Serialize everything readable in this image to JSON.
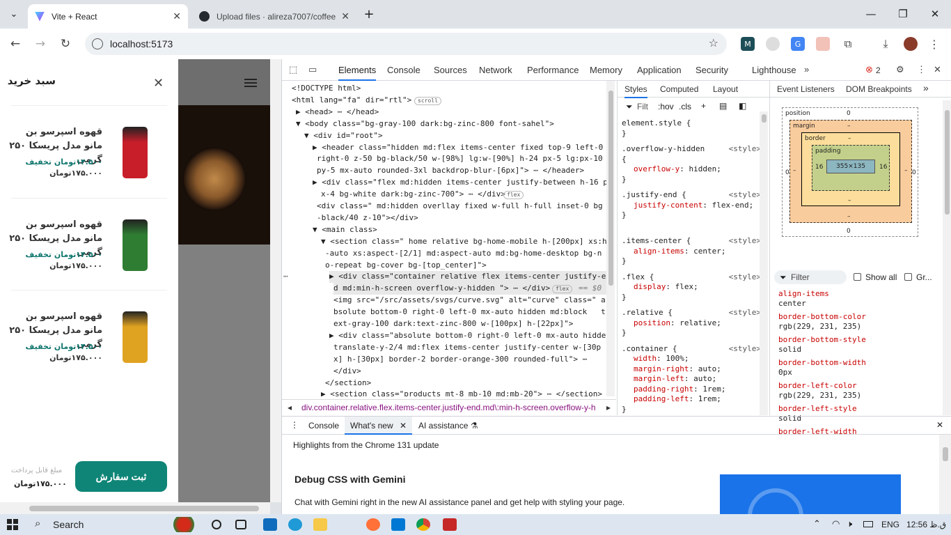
{
  "tabs": [
    {
      "title": "Vite + React",
      "active": true
    },
    {
      "title": "Upload files · alireza7007/coffee",
      "active": false
    }
  ],
  "address": {
    "url": "localhost:5173"
  },
  "cart": {
    "title": "سبد خرید",
    "items": [
      {
        "name": "قهوه اسپرسو بن مانو مدل پریسکا ۲۵۰ گرمی",
        "discount": "۱۴.۵۰۰تومان تخفیف",
        "price": "۱۷۵.۰۰۰تومان",
        "pack_color": "#c81e2a"
      },
      {
        "name": "قهوه اسپرسو بن مانو مدل پریسکا ۲۵۰ گرمی",
        "discount": "۱۴.۵۰۰تومان تخفیف",
        "price": "۱۷۵.۰۰۰تومان",
        "pack_color": "#2f7d32"
      },
      {
        "name": "قهوه اسپرسو بن مانو مدل پریسکا ۲۵۰ گرمی",
        "discount": "۱۴.۵۰۰تومان تخفیف",
        "price": "۱۷۵.۰۰۰تومان",
        "pack_color": "#e0a321"
      }
    ],
    "pay_label": "مبلغ قابل پرداخت",
    "pay_total": "۱۷۵.۰۰۰تومان",
    "submit_label": "ثبت سفارش"
  },
  "devtools": {
    "tabs": [
      "Elements",
      "Console",
      "Sources",
      "Network",
      "Performance",
      "Memory",
      "Application",
      "Security",
      "Lighthouse"
    ],
    "error_count": "2",
    "elements_lines": [
      "<!DOCTYPE html>",
      "<html lang=\"fa\" dir=\"rtl\">",
      "▶ <head> ⋯ </head>",
      "▼ <body class=\"bg-gray-100 dark:bg-zinc-800 font-sahel\">",
      "▼ <div id=\"root\">",
      "▶ <header class=\"hidden md:flex items-center fixed top-9 left-0",
      "right-0 z-50 bg-black/50 w-[98%] lg:w-[90%] h-24 px-5 lg:px-10",
      "py-5 mx-auto rounded-3xl backdrop-blur-[6px]\"> ⋯ </header>",
      "▶ <div class=\"flex md:hidden items-center justify-between h-16 p",
      "x-4 bg-white dark:bg-zinc-700\"> ⋯ </div>",
      "<div class=\" md:hidden overllay fixed w-full h-full inset-0 bg",
      "-black/40 z-10\"></div>",
      "▼ <main class>",
      "▼ <section class=\" home relative bg-home-mobile h-[200px] xs:h",
      "-auto xs:aspect-[2/1] md:aspect-auto md:bg-home-desktop bg-n",
      "o-repeat bg-cover bg-[top_center]\">",
      "▶ <div class=\"container relative flex items-center justify-en",
      "d md:min-h-screen overflow-y-hidden \"> ⋯ </div>",
      "<img src=\"/src/assets/svgs/curve.svg\" alt=\"curve\" class=\" a",
      "bsolute bottom-0 right-0 left-0 mx-auto hidden md:block   t",
      "ext-gray-100 dark:text-zinc-800 w-[100px] h-[22px]\">",
      "▶ <div class=\"absolute bottom-0 right-0 left-0 mx-auto hidden",
      "translate-y-2/4 md:flex items-center justify-center w-[30p",
      "x] h-[30px] border-2 border-orange-300 rounded-full\"> ⋯",
      "</div>",
      "</section>",
      "▶ <section class=\"products mt-8 mb-10 md:mb-20\"> ⋯ </section>"
    ],
    "pills": {
      "scroll": "scroll",
      "flex": "flex",
      "eq": "== $0"
    },
    "breadcrumb": "div.container.relative.flex.items-center.justify-end.md\\:min-h-screen.overflow-y-h",
    "styles_tabs": [
      "Styles",
      "Computed",
      "Layout",
      "Event Listeners",
      "DOM Breakpoints"
    ],
    "filter_label": "Filt",
    "hov": ":hov",
    "cls": ".cls",
    "rules": [
      {
        "selector": "element.style {",
        "src": "",
        "props": []
      },
      {
        "selector": ".overflow-y-hidden",
        "src": "<style>",
        "props": [
          [
            "overflow-y",
            "hidden;"
          ]
        ]
      },
      {
        "selector": ".justify-end {",
        "src": "<style>",
        "props": [
          [
            "justify-content",
            "flex-end;"
          ]
        ]
      },
      {
        "selector": ".items-center {",
        "src": "<style>",
        "props": [
          [
            "align-items",
            "center;"
          ]
        ]
      },
      {
        "selector": ".flex {",
        "src": "<style>",
        "props": [
          [
            "display",
            "flex;"
          ]
        ]
      },
      {
        "selector": ".relative {",
        "src": "<style>",
        "props": [
          [
            "position",
            "relative;"
          ]
        ]
      },
      {
        "selector": ".container {",
        "src": "<style>",
        "props": [
          [
            "width",
            "100%;"
          ],
          [
            "margin-right",
            "auto;"
          ],
          [
            "margin-left",
            "auto;"
          ],
          [
            "padding-right",
            "1rem;"
          ],
          [
            "padding-left",
            "1rem;"
          ]
        ]
      }
    ],
    "box": {
      "position_label": "position",
      "position_val": "0",
      "margin_label": "margin",
      "border_label": "border",
      "padding_label": "padding",
      "content": "355×135",
      "pad_side": "16",
      "dash": "–",
      "zero": "0"
    },
    "computed_filter": "Filter",
    "show_all": "Show all",
    "group": "Gr...",
    "computed": [
      {
        "prop": "align-items",
        "val": "center"
      },
      {
        "prop": "border-bottom-color",
        "val": "rgb(229, 231, 235)"
      },
      {
        "prop": "border-bottom-style",
        "val": "solid"
      },
      {
        "prop": "border-bottom-width",
        "val": "0px"
      },
      {
        "prop": "border-left-color",
        "val": "rgb(229, 231, 235)"
      },
      {
        "prop": "border-left-style",
        "val": "solid"
      },
      {
        "prop": "border-left-width",
        "val": ""
      }
    ],
    "drawer": {
      "tabs": [
        "Console",
        "What's new",
        "AI assistance"
      ],
      "highlight": "Highlights from the Chrome 131 update",
      "heading": "Debug CSS with Gemini",
      "body": "Chat with Gemini right in the new AI assistance panel and get help with styling your page."
    }
  },
  "taskbar": {
    "search": "Search",
    "lang": "ENG",
    "time": "12:56 ق.ظ"
  }
}
